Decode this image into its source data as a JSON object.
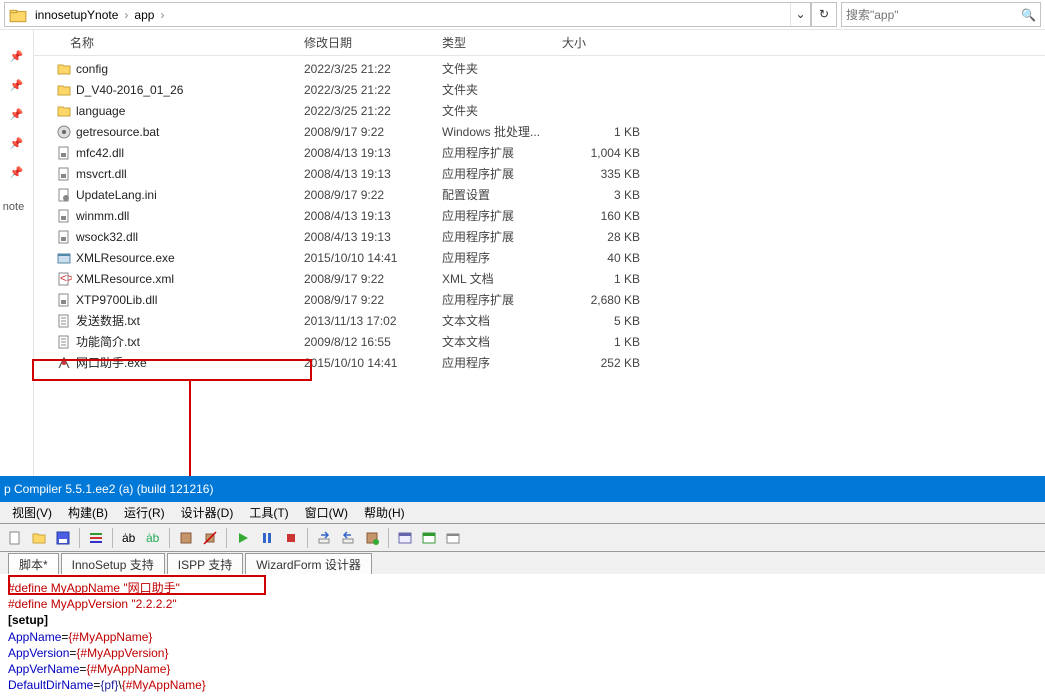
{
  "explorer": {
    "breadcrumb": [
      "innosetupYnote",
      "app"
    ],
    "search_placeholder": "搜索\"app\"",
    "nav_label": "note",
    "columns": {
      "name": "名称",
      "date": "修改日期",
      "type": "类型",
      "size": "大小"
    },
    "rows": [
      {
        "icon": "folder",
        "name": "config",
        "date": "2022/3/25 21:22",
        "type": "文件夹",
        "size": ""
      },
      {
        "icon": "folder",
        "name": "D_V40-2016_01_26",
        "date": "2022/3/25 21:22",
        "type": "文件夹",
        "size": ""
      },
      {
        "icon": "folder",
        "name": "language",
        "date": "2022/3/25 21:22",
        "type": "文件夹",
        "size": ""
      },
      {
        "icon": "bat",
        "name": "getresource.bat",
        "date": "2008/9/17 9:22",
        "type": "Windows 批处理...",
        "size": "1 KB"
      },
      {
        "icon": "dll",
        "name": "mfc42.dll",
        "date": "2008/4/13 19:13",
        "type": "应用程序扩展",
        "size": "1,004 KB"
      },
      {
        "icon": "dll",
        "name": "msvcrt.dll",
        "date": "2008/4/13 19:13",
        "type": "应用程序扩展",
        "size": "335 KB"
      },
      {
        "icon": "ini",
        "name": "UpdateLang.ini",
        "date": "2008/9/17 9:22",
        "type": "配置设置",
        "size": "3 KB"
      },
      {
        "icon": "dll",
        "name": "winmm.dll",
        "date": "2008/4/13 19:13",
        "type": "应用程序扩展",
        "size": "160 KB"
      },
      {
        "icon": "dll",
        "name": "wsock32.dll",
        "date": "2008/4/13 19:13",
        "type": "应用程序扩展",
        "size": "28 KB"
      },
      {
        "icon": "exe",
        "name": "XMLResource.exe",
        "date": "2015/10/10 14:41",
        "type": "应用程序",
        "size": "40 KB"
      },
      {
        "icon": "xml",
        "name": "XMLResource.xml",
        "date": "2008/9/17 9:22",
        "type": "XML 文档",
        "size": "1 KB"
      },
      {
        "icon": "dll",
        "name": "XTP9700Lib.dll",
        "date": "2008/9/17 9:22",
        "type": "应用程序扩展",
        "size": "2,680 KB"
      },
      {
        "icon": "txt",
        "name": "发送数据.txt",
        "date": "2013/11/13 17:02",
        "type": "文本文档",
        "size": "5 KB"
      },
      {
        "icon": "txt",
        "name": "功能简介.txt",
        "date": "2009/8/12 16:55",
        "type": "文本文档",
        "size": "1 KB"
      },
      {
        "icon": "exe2",
        "name": "网口助手.exe",
        "date": "2015/10/10 14:41",
        "type": "应用程序",
        "size": "252 KB"
      }
    ]
  },
  "editor": {
    "title": "p Compiler 5.5.1.ee2 (a) (build 121216)",
    "menu": [
      "视图(V)",
      "构建(B)",
      "运行(R)",
      "设计器(D)",
      "工具(T)",
      "窗口(W)",
      "帮助(H)"
    ],
    "tabs": [
      "脚本*",
      "InnoSetup 支持",
      "ISPP 支持",
      "WizardForm 设计器"
    ],
    "code": {
      "l1a": "#define ",
      "l1b": "MyAppName ",
      "l1c": "\"网口助手\"",
      "l2a": "#define ",
      "l2b": "MyAppVersion ",
      "l2c": "\"2.2.2.2\"",
      "l3": "[setup]",
      "l4a": "AppName",
      "l4b": "=",
      "l4c": "{#MyAppName}",
      "l5a": "AppVersion",
      "l5b": "=",
      "l5c": "{#MyAppVersion}",
      "l6a": "AppVerName",
      "l6b": "=",
      "l6c": "{#MyAppName}",
      "l7a": "DefaultDirName",
      "l7b": "=",
      "l7c": "{pf}",
      "l7d": "\\",
      "l7e": "{#MyAppName}"
    }
  }
}
